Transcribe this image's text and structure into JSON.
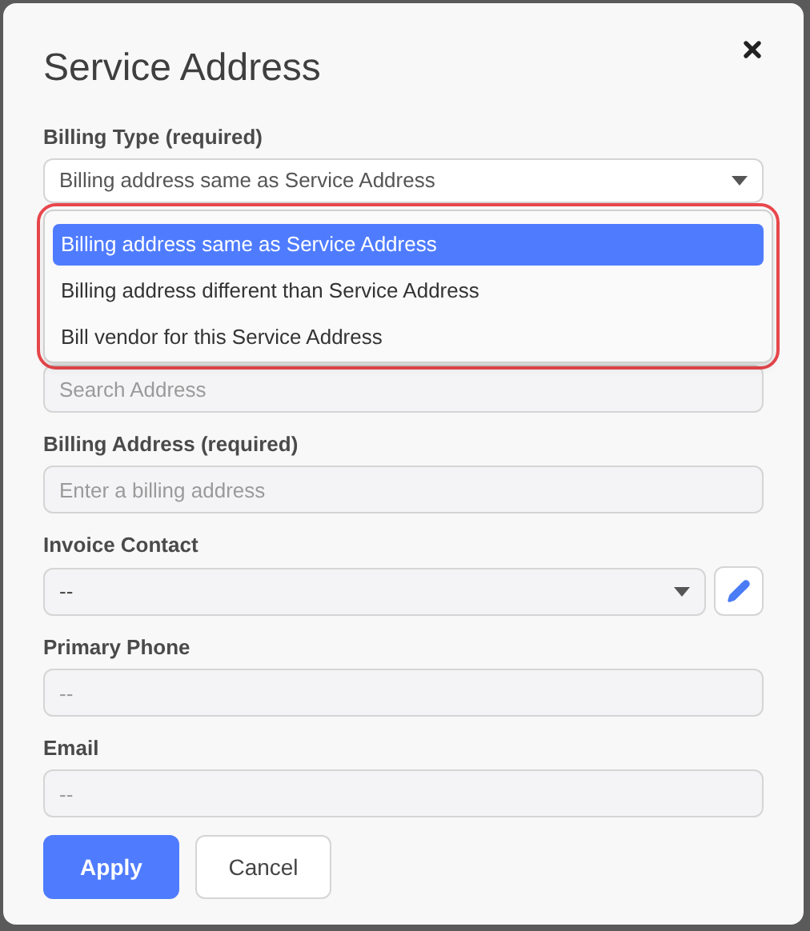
{
  "dialog": {
    "title": "Service Address"
  },
  "billing_type": {
    "label": "Billing Type (required)",
    "value": "Billing address same as Service Address",
    "expanded": true,
    "options": [
      {
        "label": "Billing address same as Service Address",
        "selected": true
      },
      {
        "label": "Billing address different than Service Address",
        "selected": false
      },
      {
        "label": "Bill vendor for this Service Address",
        "selected": false
      }
    ]
  },
  "fields": [
    {
      "kind": "input",
      "placeholder": "Search Address"
    },
    {
      "kind": "input",
      "label": "Billing Address (required)",
      "placeholder": "Enter a billing address"
    },
    {
      "kind": "select",
      "label": "Invoice Contact",
      "value": "--"
    },
    {
      "kind": "input",
      "label": "Primary Phone",
      "placeholder": "--"
    },
    {
      "kind": "input",
      "label": "Email",
      "placeholder": "--"
    }
  ],
  "buttons": [
    {
      "kind": "primary",
      "label": "Apply"
    },
    {
      "kind": "secondary",
      "label": "Cancel"
    }
  ]
}
